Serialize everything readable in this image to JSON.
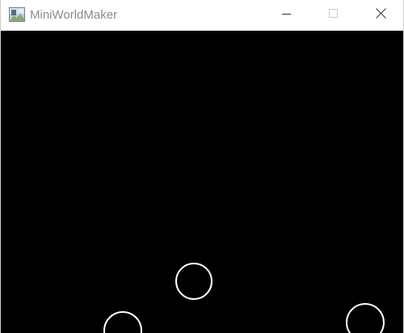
{
  "window": {
    "title": "MiniWorldMaker",
    "icon": "landscape-app-icon"
  },
  "titlebar_buttons": {
    "minimize_icon": "minimize-icon",
    "maximize_icon": "maximize-icon",
    "close_icon": "close-icon"
  },
  "canvas": {
    "background_color": "#000000",
    "circle_stroke_color": "#ffffff",
    "circle_count": 3
  }
}
